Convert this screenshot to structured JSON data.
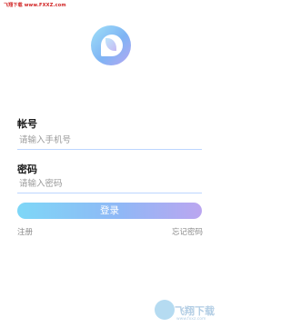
{
  "watermark": {
    "top_text": "飞翔下载 www.FXXZ.com",
    "bottom_text": "飞翔下载",
    "bottom_url": "www.fxxz.com"
  },
  "form": {
    "account_label": "帐号",
    "account_placeholder": "请输入手机号",
    "password_label": "密码",
    "password_placeholder": "请输入密码",
    "login_button": "登录",
    "register_link": "注册",
    "forgot_link": "忘记密码"
  },
  "icons": {
    "logo": "app-logo-icon"
  },
  "colors": {
    "accent_start": "#7ed7f7",
    "accent_end": "#bba6f0",
    "underline": "#bcd6ff",
    "watermark_red": "#d02020"
  }
}
